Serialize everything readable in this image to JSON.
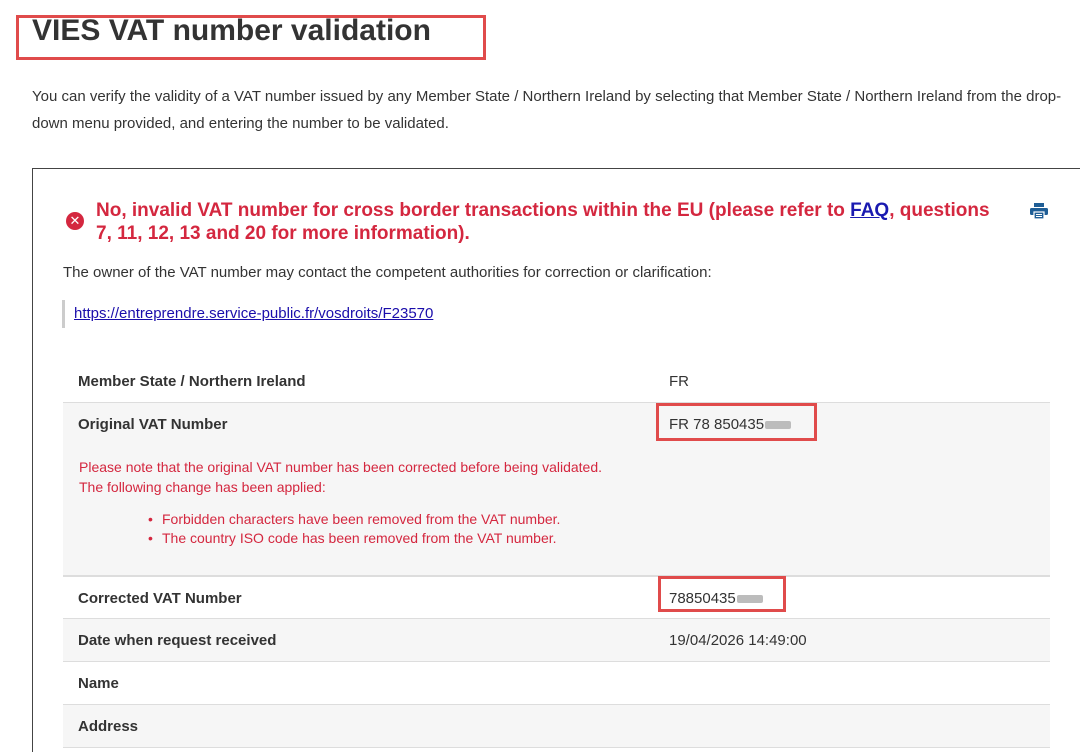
{
  "page": {
    "title": "VIES VAT number validation",
    "intro": "You can verify the validity of a VAT number issued by any Member State / Northern Ireland by selecting that Member State / Northern Ireland from the drop-down menu provided, and entering the number to be validated."
  },
  "result": {
    "message_before": "No, invalid VAT number for cross border transactions within the EU (please refer to ",
    "faq_link": "FAQ",
    "message_after": ", questions 7, 11, 12, 13 and 20 for more information).",
    "owner_note": "The owner of the VAT number may contact the competent authorities for correction or clarification:",
    "authority_link": "https://entreprendre.service-public.fr/vosdroits/F23570"
  },
  "details": {
    "member_state_label": "Member State / Northern Ireland",
    "member_state_value": "FR",
    "original_vat_label": "Original VAT Number",
    "original_vat_value": "FR 78 850435",
    "warning_line1": "Please note that the original VAT number has been corrected before being validated.",
    "warning_line2": "The following change has been applied:",
    "changes": [
      "Forbidden characters have been removed from the VAT number.",
      "The country ISO code has been removed from the VAT number."
    ],
    "corrected_vat_label": "Corrected VAT Number",
    "corrected_vat_value": "78850435",
    "date_label": "Date when request received",
    "date_value": "19/04/2026 14:49:00",
    "name_label": "Name",
    "address_label": "Address"
  },
  "colors": {
    "error_red": "#d4273f",
    "annotation_red": "#e04b4b",
    "link_blue": "#1a0dab",
    "print_icon_blue": "#1f5e96"
  },
  "icons": {
    "error": "error-circle-icon",
    "print": "print-icon"
  }
}
